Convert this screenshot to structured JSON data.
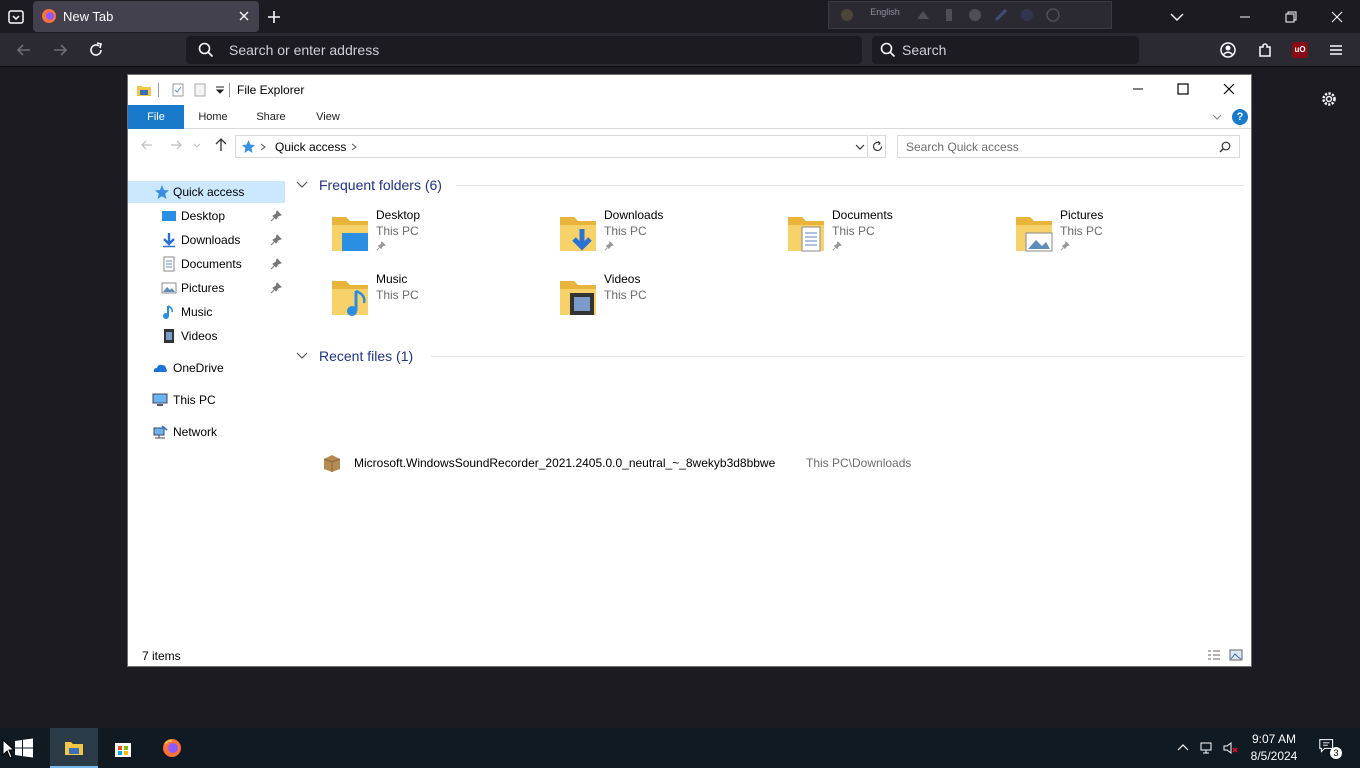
{
  "browser": {
    "tab_title": "New Tab",
    "url_placeholder": "Search or enter address",
    "search_placeholder": "Search",
    "ime_language": "English",
    "ublock_label": "uO"
  },
  "explorer": {
    "title": "File Explorer",
    "ribbon_tabs": [
      "File",
      "Home",
      "Share",
      "View"
    ],
    "help_label": "?",
    "breadcrumb": "Quick access",
    "search_placeholder": "Search Quick access",
    "nav": {
      "quick_access": "Quick access",
      "items": [
        "Desktop",
        "Downloads",
        "Documents",
        "Pictures",
        "Music",
        "Videos"
      ],
      "onedrive": "OneDrive",
      "this_pc": "This PC",
      "network": "Network"
    },
    "frequent_title": "Frequent folders (6)",
    "folders": [
      {
        "name": "Desktop",
        "location": "This PC",
        "pinned": true
      },
      {
        "name": "Downloads",
        "location": "This PC",
        "pinned": true
      },
      {
        "name": "Documents",
        "location": "This PC",
        "pinned": true
      },
      {
        "name": "Pictures",
        "location": "This PC",
        "pinned": true
      },
      {
        "name": "Music",
        "location": "This PC",
        "pinned": false
      },
      {
        "name": "Videos",
        "location": "This PC",
        "pinned": false
      }
    ],
    "recent_title": "Recent files (1)",
    "recent": [
      {
        "name": "Microsoft.WindowsSoundRecorder_2021.2405.0.0_neutral_~_8wekyb3d8bbwe",
        "path": "This PC\\Downloads"
      }
    ],
    "status": "7 items"
  },
  "taskbar": {
    "time": "9:07 AM",
    "date": "8/5/2024",
    "notification_count": "3",
    "accent_color": "#76b9ed"
  }
}
